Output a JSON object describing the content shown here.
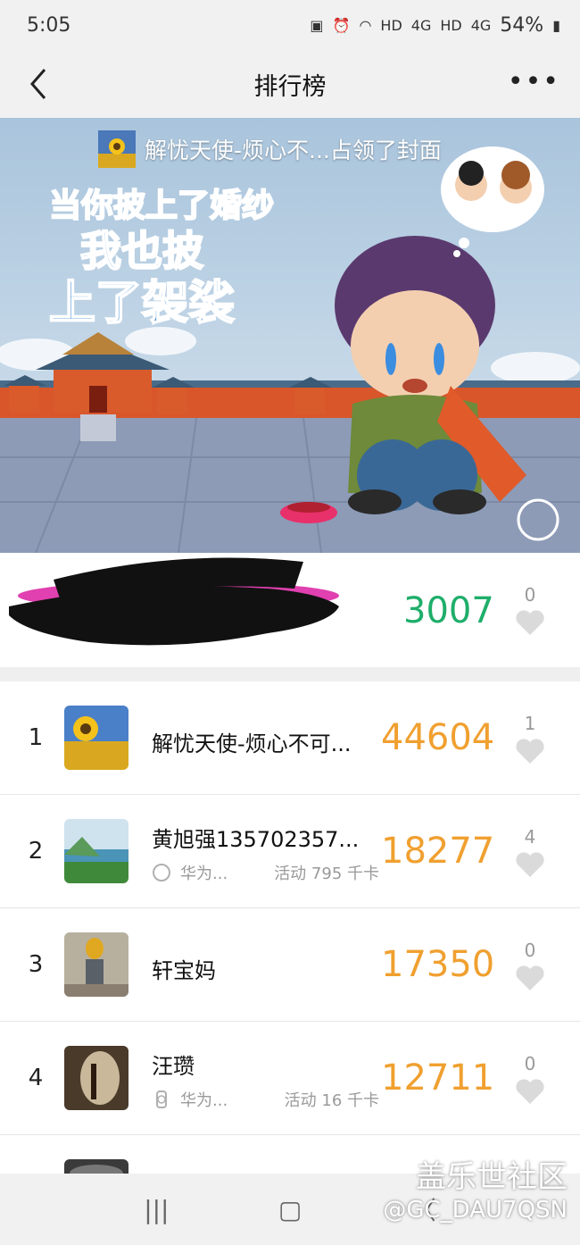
{
  "status_bar": {
    "time": "5:05",
    "battery": "54%",
    "icons": [
      "nfc-icon",
      "alarm-icon",
      "wifi-icon",
      "hd-signal-icon",
      "hd-signal-icon",
      "battery-icon"
    ],
    "hd1": "HD",
    "hd2": "HD",
    "net1": "4G",
    "net2": "4G"
  },
  "header": {
    "title": "排行榜",
    "back_icon": "chevron-left-icon",
    "more_icon": "more-horizontal-icon"
  },
  "cover": {
    "owner_text": "解忧天使-烦心不...占领了封面",
    "image_text_lines": [
      "当你披上了婚纱",
      "我也披",
      "上了袈裟"
    ]
  },
  "self_entry": {
    "steps": "3007",
    "likes": "0"
  },
  "ranking": [
    {
      "rank": "1",
      "name": "解忧天使-烦心不可...",
      "device": "",
      "activity": "",
      "steps": "44604",
      "likes": "1",
      "avatar": "sunflower-field"
    },
    {
      "rank": "2",
      "name": "黄旭强135702357...",
      "device": "华为...",
      "activity": "活动 795 千卡",
      "steps": "18277",
      "likes": "4",
      "avatar": "lake-landscape"
    },
    {
      "rank": "3",
      "name": "轩宝妈",
      "device": "",
      "activity": "",
      "steps": "17350",
      "likes": "0",
      "avatar": "child-photo"
    },
    {
      "rank": "4",
      "name": "汪瓒",
      "device": "华为...",
      "activity": "活动 16 千卡",
      "steps": "12711",
      "likes": "0",
      "avatar": "dark-art"
    }
  ],
  "watermark": {
    "line1": "盖乐世社区",
    "line2": "@GC_DAU7QSN"
  },
  "colors": {
    "self_steps": "#1eae6a",
    "rank_steps": "#f0a030"
  }
}
